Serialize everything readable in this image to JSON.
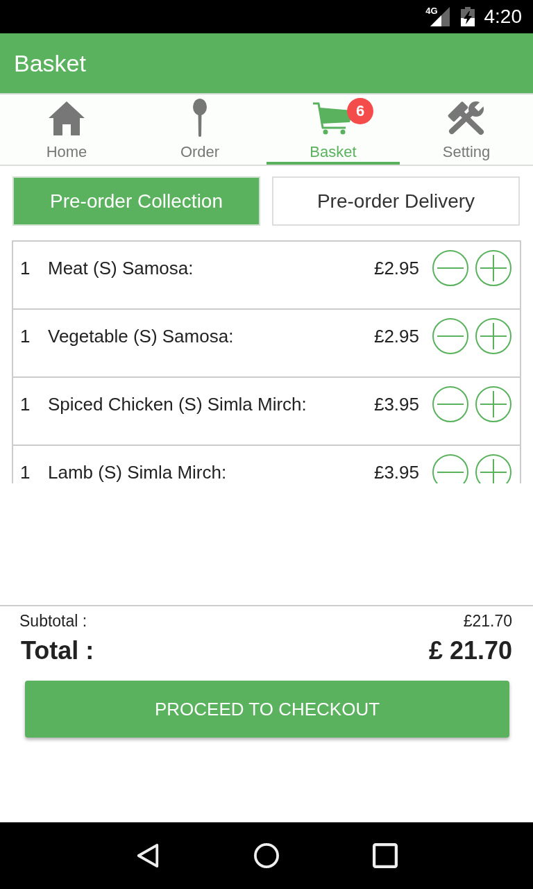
{
  "status_bar": {
    "network": "4G",
    "time": "4:20"
  },
  "app_bar": {
    "title": "Basket"
  },
  "tabs": [
    {
      "kind": "home",
      "label": "Home",
      "selected": false
    },
    {
      "kind": "spoon",
      "label": "Order",
      "selected": false
    },
    {
      "kind": "cart",
      "label": "Basket",
      "selected": true,
      "badge": "6"
    },
    {
      "kind": "tools",
      "label": "Setting",
      "selected": false
    }
  ],
  "order_type": [
    {
      "label": "Pre-order Collection",
      "selected": true
    },
    {
      "label": "Pre-order Delivery",
      "selected": false
    }
  ],
  "basket_items": [
    {
      "quantity": "1",
      "name": "Meat (S) Samosa:",
      "price": "£2.95"
    },
    {
      "quantity": "1",
      "name": "Vegetable (S) Samosa:",
      "price": "£2.95"
    },
    {
      "quantity": "1",
      "name": "Spiced Chicken (S) Simla Mirch:",
      "price": "£3.95"
    },
    {
      "quantity": "1",
      "name": "Lamb (S) Simla Mirch:",
      "price": "£3.95"
    }
  ],
  "summary": {
    "subtotal_label": "Subtotal :",
    "subtotal": "£21.70",
    "total_label": "Total :",
    "total": "£ 21.70"
  },
  "checkout_button": {
    "label": "PROCEED TO CHECKOUT"
  }
}
